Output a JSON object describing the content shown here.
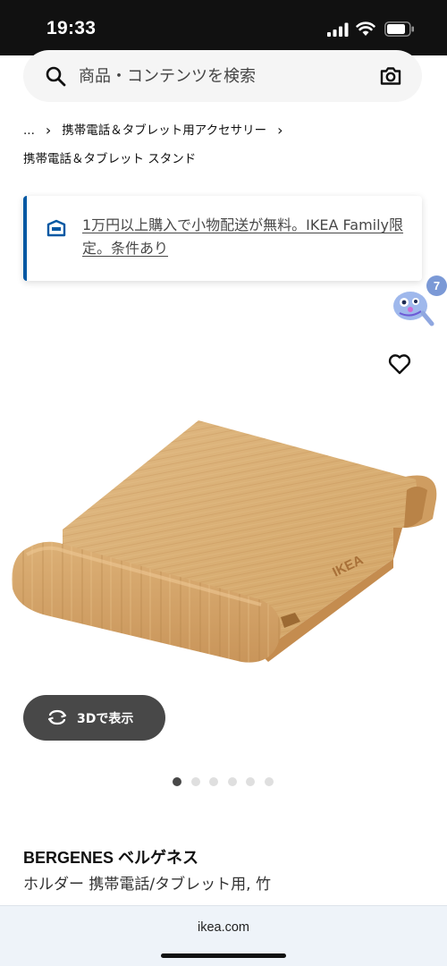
{
  "status_bar": {
    "time": "19:33"
  },
  "search": {
    "placeholder": "商品・コンテンツを検索"
  },
  "breadcrumb": {
    "ellipsis": "...",
    "category": "携帯電話＆タブレット用アクセサリー",
    "current": "携帯電話＆タブレット スタンド"
  },
  "banner": {
    "text": "1万円以上購入で小物配送が無料。IKEA Family限定。条件あり"
  },
  "assistant": {
    "badge_count": "7"
  },
  "product_image": {
    "brand_mark": "IKEA"
  },
  "view3d": {
    "label": "3Dで表示"
  },
  "gallery": {
    "total": 6,
    "active_index": 0
  },
  "product": {
    "name": "BERGENES ベルゲネス",
    "description": "ホルダー 携帯電話/タブレット用, 竹"
  },
  "browser": {
    "url": "ikea.com"
  },
  "icons": {
    "search": "search-icon",
    "camera": "camera-icon",
    "truck": "truck-icon",
    "heart": "heart-icon",
    "rotate": "rotate-3d-icon"
  },
  "colors": {
    "accent": "#0058a3",
    "dark_button": "#484848",
    "wood": "#d8ae74"
  }
}
